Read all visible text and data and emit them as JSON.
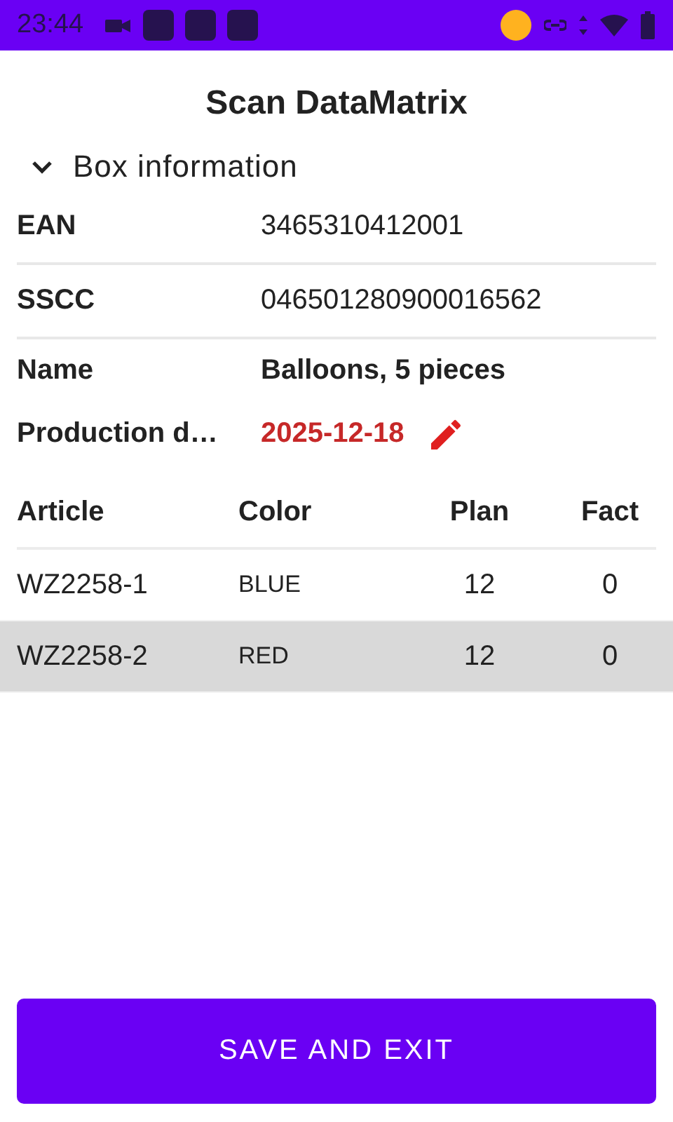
{
  "status_bar": {
    "time": "23:44"
  },
  "title": "Scan DataMatrix",
  "section": {
    "label": "Box information",
    "expanded": true
  },
  "fields": [
    {
      "label": "EAN",
      "value": "3465310412001",
      "kind": "plain"
    },
    {
      "label": "SSCC",
      "value": "046501280900016562",
      "kind": "plain"
    },
    {
      "label": "Name",
      "value": "Balloons, 5 pieces",
      "kind": "bold"
    },
    {
      "label": "Production d…",
      "value": "2025-12-18",
      "kind": "date"
    }
  ],
  "table": {
    "columns": [
      "Article",
      "Color",
      "Plan",
      "Fact"
    ],
    "rows": [
      {
        "cells": [
          "WZ2258-1",
          "BLUE",
          "12",
          "0"
        ],
        "selected": false
      },
      {
        "cells": [
          "WZ2258-2",
          "RED",
          "12",
          "0"
        ],
        "selected": true
      }
    ]
  },
  "button": "SAVE AND EXIT"
}
